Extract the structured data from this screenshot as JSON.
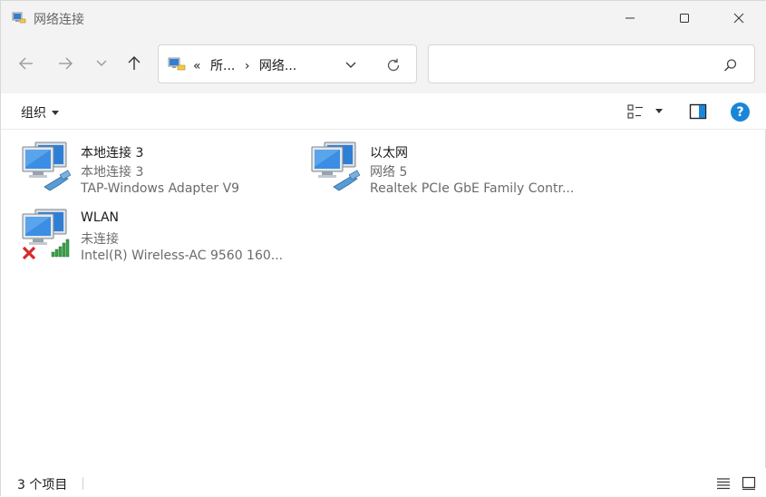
{
  "window": {
    "title": "网络连接",
    "minimize_icon": "minimize-icon",
    "maximize_icon": "maximize-icon",
    "close_icon": "close-icon"
  },
  "nav": {
    "back_icon": "arrow-left-icon",
    "forward_icon": "arrow-right-icon",
    "recent_icon": "chevron-down-icon",
    "up_icon": "arrow-up-icon",
    "address": {
      "icon": "network-folder-icon",
      "prefix": "«",
      "segments": [
        "所...",
        "网络..."
      ],
      "separator": "›"
    },
    "refresh_icon": "refresh-icon",
    "search": {
      "value": "",
      "placeholder": ""
    }
  },
  "commandbar": {
    "organize_label": "组织",
    "view_icon": "view-options-icon",
    "preview_icon": "preview-pane-icon",
    "help_label": "?"
  },
  "connections": [
    {
      "name": "本地连接 3",
      "status": "本地连接 3",
      "device": "TAP-Windows Adapter V9",
      "icon": "wired-network-icon",
      "disconnected": false
    },
    {
      "name": "以太网",
      "status": "网络 5",
      "device": "Realtek PCIe GbE Family Contr...",
      "icon": "wired-network-icon",
      "disconnected": false
    },
    {
      "name": "WLAN",
      "status": "未连接",
      "device": "Intel(R) Wireless-AC 9560 160...",
      "icon": "wireless-network-icon",
      "disconnected": true
    }
  ],
  "statusbar": {
    "count_label": "3 个项目",
    "details_view_icon": "details-view-icon",
    "large_icons_view_icon": "large-icons-view-icon"
  },
  "colors": {
    "chrome_bg": "#f3f3f3",
    "accent": "#1a86d9",
    "monitor_blue": "#2f7fd6",
    "disconnect_red": "#d62b2b",
    "signal_green": "#3aa34a"
  }
}
